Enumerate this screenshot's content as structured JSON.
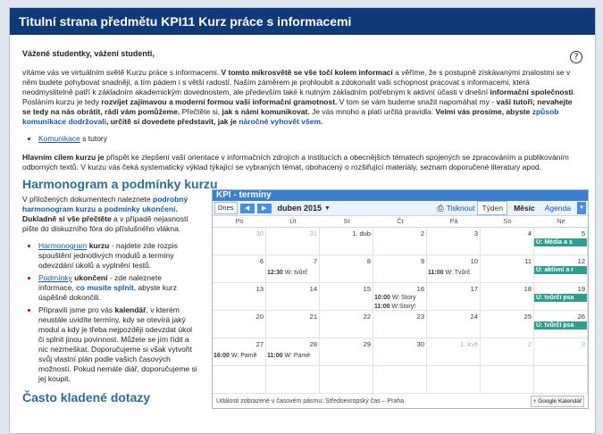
{
  "header": {
    "title": "Titulní strana předmětu KPI11 Kurz práce s informacemi"
  },
  "greeting": "Vážené studentky, vážení studenti,",
  "intro": {
    "p1": "vítáme vás ve virtuálním světě Kurzu práce s informacemi. ",
    "p1_bold": "V tomto mikrosvětě se vše točí kolem informací",
    "p2": " a věříme, že s postupně získávanými znalostmi se v něm budete pohybovat snadněji, a tím pádem i s větší radostí. Naším záměrem je prohloubit a zdokonalit vaši schopnost pracovat s informacemi, která neodmyslitelně patří k základním akademickým dovednostem, ale především také k nutným základním potřebným k aktivní účasti v dnešní ",
    "p2_bold": "informační společnosti",
    "p3": ". Posláním kurzu je tedy ",
    "p3_bold": "rozvíjet zajímavou a moderní formou vaši informační gramotnost.",
    "p4": " V tom se vám budeme snažit napomáhat my - ",
    "p4_bold": "vaši tutoři; nevahejte se tedy na nás obrátit, rádi vám pomůžeme.",
    "p5": " Přečtěte si, ",
    "p5_bold": "jak s námi komunikovat.",
    "p6": " Je vás mnoho a platí určitá pravidla. ",
    "p6_bold": "Velmi vás prosíme, abyste",
    "p6_blue": " způsob komunikace dodržovali",
    "p6_bold2": ", určitě si dovedete představit, jak je",
    "p6_blue2": " náročné vyhovět všem."
  },
  "tutor_link": {
    "link": "Komunikace",
    "rest": " s tutory"
  },
  "goal": {
    "bold": "Hlavním cílem kurzu je",
    "text": " přispět ke zlepšení vaší orientace v informačních zdrojích a institucích a obecnějších tématech spojených se zpracováním a publikováním odborných textů. V kurzu vás čeká systematický výklad týkající se vybraných témat, obohacený o rozšiřující materiály, seznam doporučené literatury apod."
  },
  "section1": {
    "title": "Harmonogram a podmínky kurzu"
  },
  "left": {
    "intro1": "V přiložených dokumentech naleznete ",
    "intro_blue": "podrobný harmonogram kurzu a podmínky ukončení.",
    "intro_bold": " Dukladně si vše přečtěte",
    "intro2": " a v případě nejasností pište do diskuzního fóra do příslušného vlákna.",
    "items": [
      {
        "link": "Harmonogram",
        "bold": " kurzu",
        "text": " - najdete zde rozpis spouštění jednotlivých modulů a termíny odevzdání úkolů a vyplnění testů."
      },
      {
        "link": "Podmínky",
        "bold": " ukončení",
        "text": " - zde naleznete informace, ",
        "blue": "co musíte splnit",
        "text2": ", abyste kurz úspěšně dokončili."
      },
      {
        "text": "Připravili jsme pro vás ",
        "bold": "kalendář",
        "text2": ", v kterém neustále uvidíte termíny, kdy se otevírá jaký modul a kdy je třeba nejpozději odevzdat úkol či splnit jinou povinnost. Můžete se jím řídit a nic nezmeškat. Doporučujeme si však vytvořit svůj vlastní plán podle vašich časových možností. Pokud nemáte diář, doporučujeme si jej koupit."
      }
    ]
  },
  "section2": {
    "title": "Často kladené dotazy"
  },
  "calendar": {
    "title": "KPI - termíny",
    "today": "Dnes",
    "period": "duben 2015",
    "print": "Tisknout",
    "views": [
      "Týden",
      "Měsíc",
      "Agenda"
    ],
    "days": [
      "Po",
      "Út",
      "St",
      "Čt",
      "Pá",
      "So",
      "Ne"
    ],
    "weeks": [
      [
        "30",
        "31",
        "1. dub",
        "2",
        "3",
        "4",
        "5"
      ],
      [
        "6",
        "7",
        "8",
        "9",
        "10",
        "11",
        "12"
      ],
      [
        "13",
        "14",
        "15",
        "16",
        "17",
        "18",
        "19"
      ],
      [
        "20",
        "21",
        "22",
        "23",
        "24",
        "25",
        "26"
      ],
      [
        "27",
        "28",
        "29",
        "30",
        "1. kvě",
        "2",
        "3"
      ]
    ],
    "events": {
      "w1_sun": "Ú: Média a s",
      "w2_tue_time": "12:30",
      "w2_tue": "W: tvůrč",
      "w2_fri_time": "11:00",
      "w2_fri": "W: Tvůrč",
      "w2_sun": "Ú: aktivní a r",
      "w3_thu1_time": "10:00",
      "w3_thu1": "W: Story",
      "w3_thu2_time": "11:00",
      "w3_thu2": "W:Story!",
      "w3_sun": "Ú: tvůrčí psa",
      "w4_sun": "Ú: tvůrčí psa",
      "w5_mon_time": "16:00",
      "w5_mon": "W: Pamě",
      "w5_tue_time": "11:00",
      "w5_tue": "W: Pamé"
    },
    "footer": "Události zobrazené v časovém pásmu: Středoevropský čas – Praha",
    "google": "Google Kalendář"
  }
}
